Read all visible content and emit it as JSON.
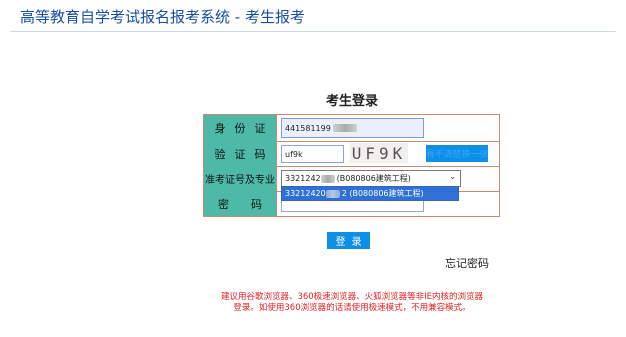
{
  "header": {
    "title": "高等教育自学考试报名报考系统 - 考生报考"
  },
  "login": {
    "heading": "考生登录",
    "id_label": "身份证",
    "id_value_prefix": "441581199",
    "code_label": "验证码",
    "code_value": "uf9k",
    "captcha_text": "UF9K",
    "captcha_button": "看不清楚换一张",
    "ticket_label": "准考证号及专业",
    "ticket_prefix": "3321242",
    "ticket_suffix": "(B080806建筑工程)",
    "dropdown_prefix": "33212420",
    "dropdown_suffix": "2 (B080806建筑工程)",
    "password_label": "密码",
    "login_button": "登录",
    "forgot": "忘记密码",
    "notice": "建议用谷歌浏览器、360极速浏览器、火狐浏览器等非IE内核的浏览器登录。如使用360浏览器的话请使用极速模式，不用兼容模式。"
  },
  "colors": {
    "label_bg": "#4fb9a8",
    "button_bg": "#0e8fe6",
    "title_color": "#1a4fa0",
    "notice_color": "#e02020"
  }
}
